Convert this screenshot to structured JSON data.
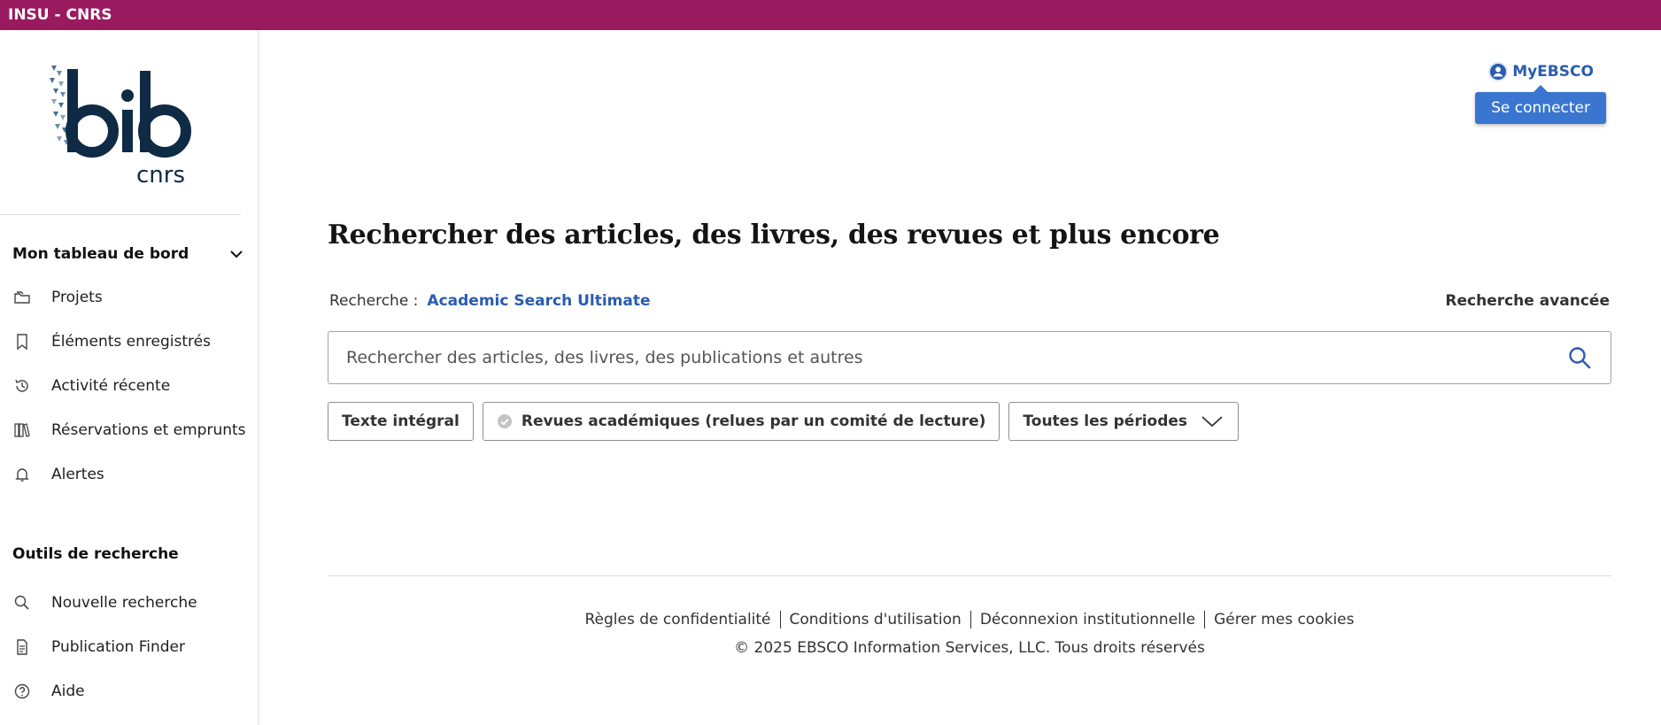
{
  "topbar": {
    "title": "INSU - CNRS"
  },
  "brand": {
    "logo_text": "bib cnrs"
  },
  "sidebar": {
    "dashboard_heading": "Mon tableau de bord",
    "dashboard_items": [
      {
        "label": "Projets",
        "icon": "folders-icon"
      },
      {
        "label": "Éléments enregistrés",
        "icon": "bookmark-icon"
      },
      {
        "label": "Activité récente",
        "icon": "history-icon"
      },
      {
        "label": "Réservations et emprunts",
        "icon": "books-icon"
      },
      {
        "label": "Alertes",
        "icon": "bell-icon"
      }
    ],
    "tools_heading": "Outils de recherche",
    "tools_items": [
      {
        "label": "Nouvelle recherche",
        "icon": "search-icon"
      },
      {
        "label": "Publication Finder",
        "icon": "document-icon"
      },
      {
        "label": "Aide",
        "icon": "help-icon"
      }
    ]
  },
  "account": {
    "label": "MyEBSCO",
    "signin": "Se connecter"
  },
  "main": {
    "headline": "Rechercher des articles, des livres, des revues et plus encore",
    "scope_label": "Recherche :",
    "scope_db": "Academic Search Ultimate",
    "advanced": "Recherche avancée",
    "search_placeholder": "Rechercher des articles, des livres, des publications et autres",
    "filters": {
      "fulltext": "Texte intégral",
      "peer_reviewed": "Revues académiques (relues par un comité de lecture)",
      "period": "Toutes les périodes"
    }
  },
  "footer": {
    "links": [
      "Règles de confidentialité",
      "Conditions d'utilisation",
      "Déconnexion institutionnelle",
      "Gérer mes cookies"
    ],
    "copyright": "© 2025 EBSCO Information Services, LLC. Tous droits réservés"
  },
  "colors": {
    "topbar": "#9a1a60",
    "link": "#2a5cb0",
    "button": "#3a76d0",
    "logo": "#0f2a44"
  }
}
